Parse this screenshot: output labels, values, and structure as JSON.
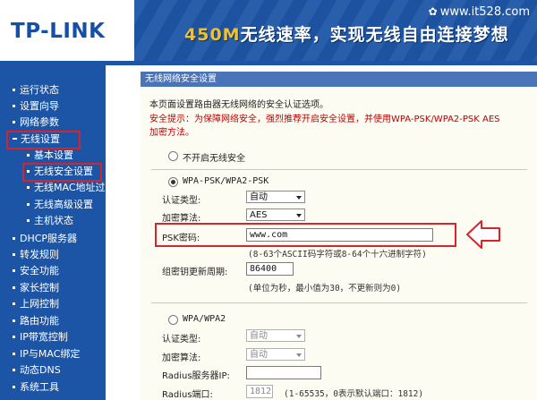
{
  "header": {
    "logo": "TP-LINK",
    "watermark": "www.it528.com",
    "slogan_highlight": "450M",
    "slogan_rest": "无线速率，实现无线自由连接梦想"
  },
  "sidebar": {
    "items": [
      {
        "label": "运行状态"
      },
      {
        "label": "设置向导"
      },
      {
        "label": "网络参数"
      },
      {
        "label": "无线设置"
      },
      {
        "label": "基本设置"
      },
      {
        "label": "无线安全设置"
      },
      {
        "label": "无线MAC地址过滤"
      },
      {
        "label": "无线高级设置"
      },
      {
        "label": "主机状态"
      },
      {
        "label": "DHCP服务器"
      },
      {
        "label": "转发规则"
      },
      {
        "label": "安全功能"
      },
      {
        "label": "家长控制"
      },
      {
        "label": "上网控制"
      },
      {
        "label": "路由功能"
      },
      {
        "label": "IP带宽控制"
      },
      {
        "label": "IP与MAC绑定"
      },
      {
        "label": "动态DNS"
      },
      {
        "label": "系统工具"
      }
    ]
  },
  "panel": {
    "title": "无线网络安全设置",
    "intro": "本页面设置路由器无线网络的安全认证选项。",
    "warning_line1": "安全提示：为保障网络安全，强烈推荐开启安全设置，并使用WPA-PSK/WPA2-PSK AES",
    "warning_line2": "加密方法。",
    "opt_none": "不开启无线安全",
    "opt_wpa_psk": "WPA-PSK/WPA2-PSK",
    "auth_type_label": "认证类型:",
    "auth_type_value": "自动",
    "enc_label": "加密算法:",
    "enc_value": "AES",
    "psk_label": "PSK密码:",
    "psk_value": "www.com",
    "psk_hint": "(8-63个ASCII码字符或8-64个十六进制字符)",
    "group_key_label": "组密钥更新周期:",
    "group_key_value": "86400",
    "group_key_hint": "(单位为秒，最小值为30，不更新则为0)",
    "opt_wpa": "WPA/WPA2",
    "auth_type2_label": "认证类型:",
    "auth_type2_value": "自动",
    "enc2_label": "加密算法:",
    "enc2_value": "自动",
    "radius_ip_label": "Radius服务器IP:",
    "radius_ip_value": "",
    "radius_port_label": "Radius端口:",
    "radius_port_value": "1812",
    "radius_port_hint": "(1-65535，0表示默认端口：1812)"
  },
  "colors": {
    "brand_blue": "#1d55a6",
    "highlight_red": "#d8232a",
    "warning_red": "#c00000",
    "slogan_yellow": "#f0c030"
  }
}
